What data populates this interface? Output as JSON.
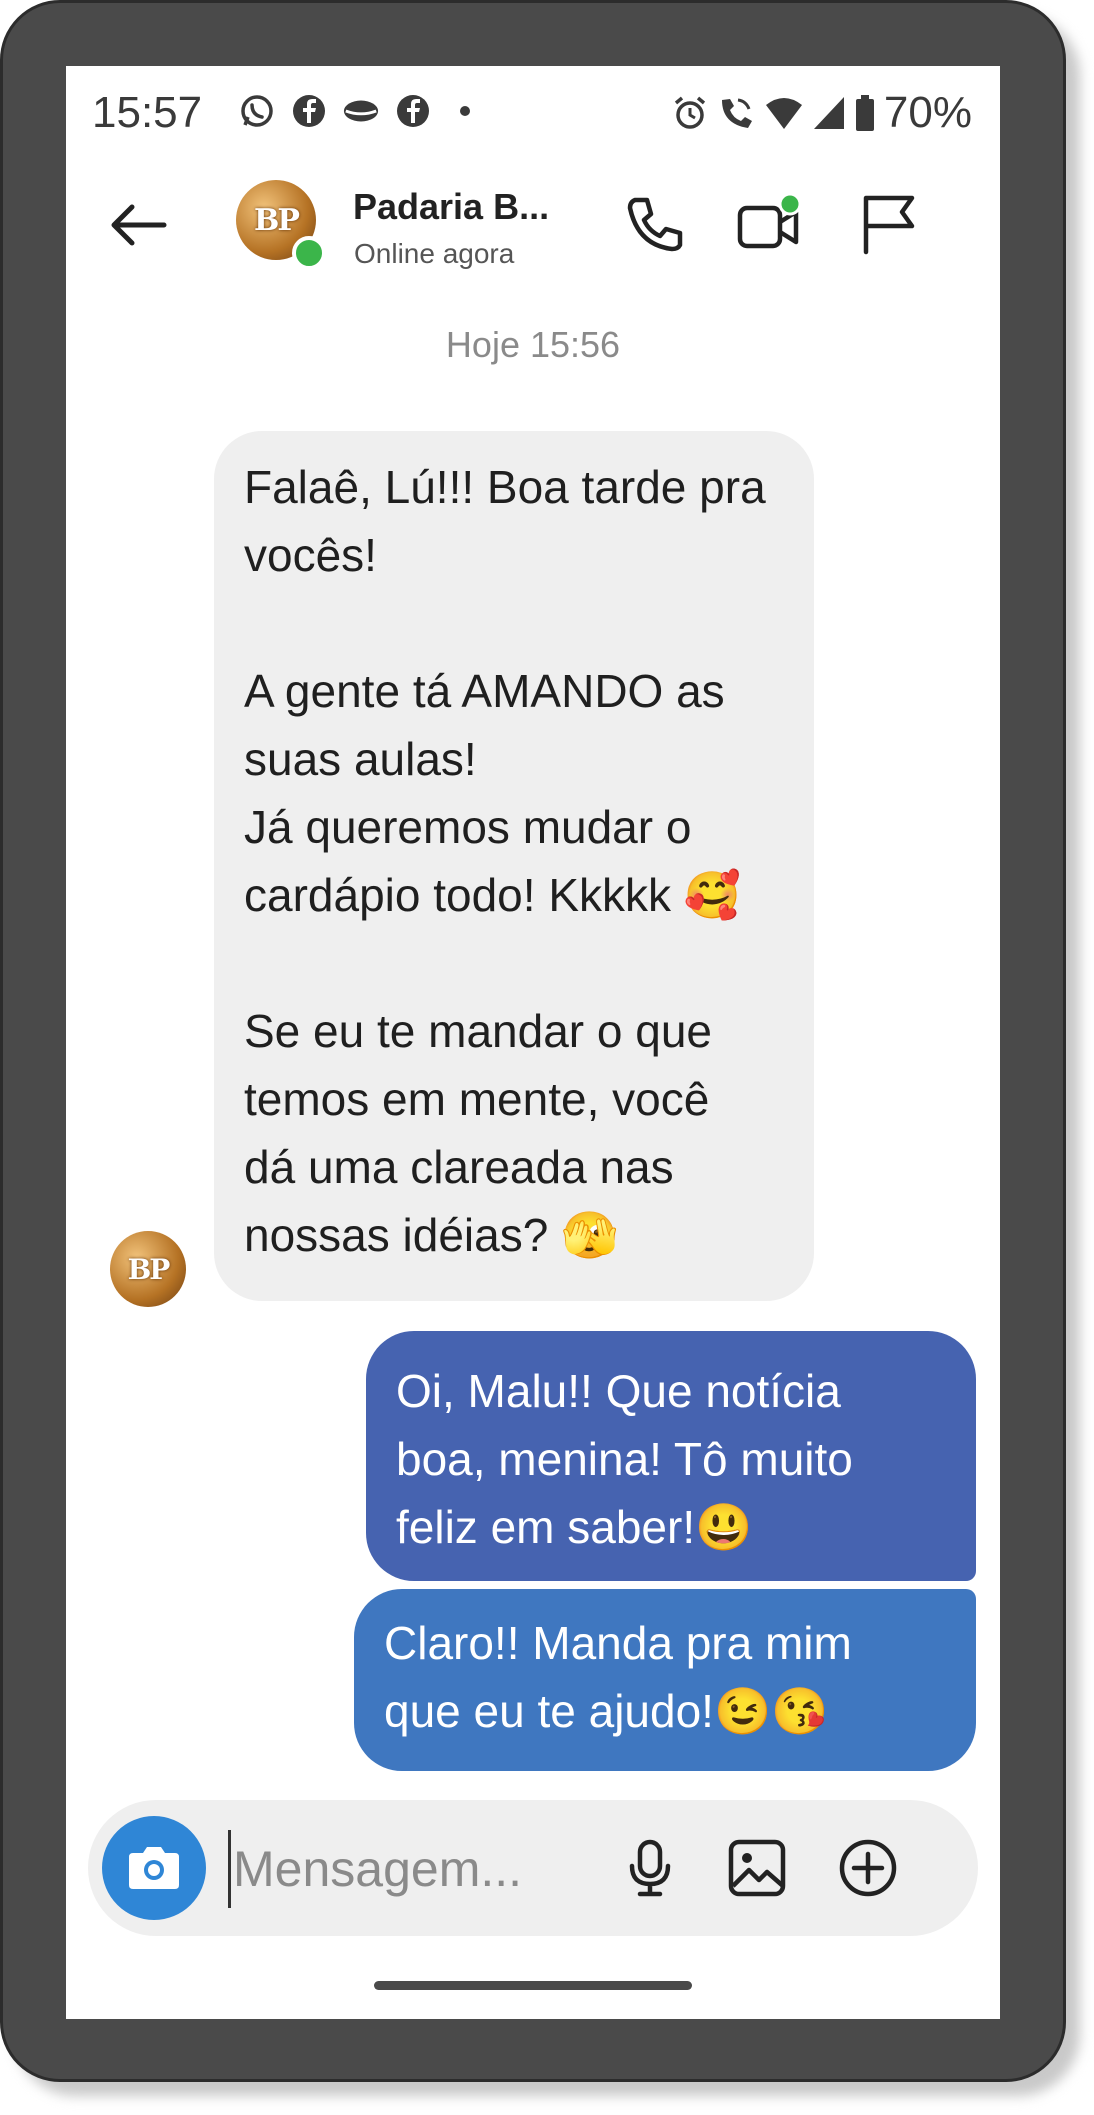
{
  "status_bar": {
    "time": "15:57",
    "battery": "70%",
    "left_icons": [
      "whatsapp-icon",
      "facebook-icon",
      "lips-icon",
      "facebook-icon",
      "dot-icon"
    ],
    "right_icons": [
      "alarm-icon",
      "wifi-call-icon",
      "wifi-icon",
      "signal-icon",
      "battery-icon"
    ]
  },
  "header": {
    "contact_name": "Padaria B...",
    "contact_status": "Online agora",
    "avatar_initials": "BP"
  },
  "chat": {
    "date_separator": "Hoje 15:56",
    "messages": [
      {
        "direction": "incoming",
        "text": "Falaê, Lú!!! Boa tarde pra\nvocês!\n\nA gente tá AMANDO as\nsuas aulas!\nJá queremos mudar o\ncardápio todo! Kkkkk 🥰\n\nSe eu te mandar o que\ntemos em mente, você\ndá uma clareada nas\nnossas idéias? 🫣"
      },
      {
        "direction": "outgoing",
        "text": "Oi, Malu!! Que notícia\nboa, menina! Tô muito\nfeliz em saber!😃"
      },
      {
        "direction": "outgoing",
        "text": "Claro!! Manda pra mim\nque eu te ajudo!😉😘"
      }
    ]
  },
  "composer": {
    "placeholder": "Mensagem..."
  },
  "colors": {
    "incoming_bubble": "#efefef",
    "outgoing_bubble_1": "#4663b0",
    "outgoing_bubble_2": "#3f77c0",
    "camera_button": "#2f86d6",
    "online": "#3bb54a",
    "frame": "#4a4a4a"
  }
}
